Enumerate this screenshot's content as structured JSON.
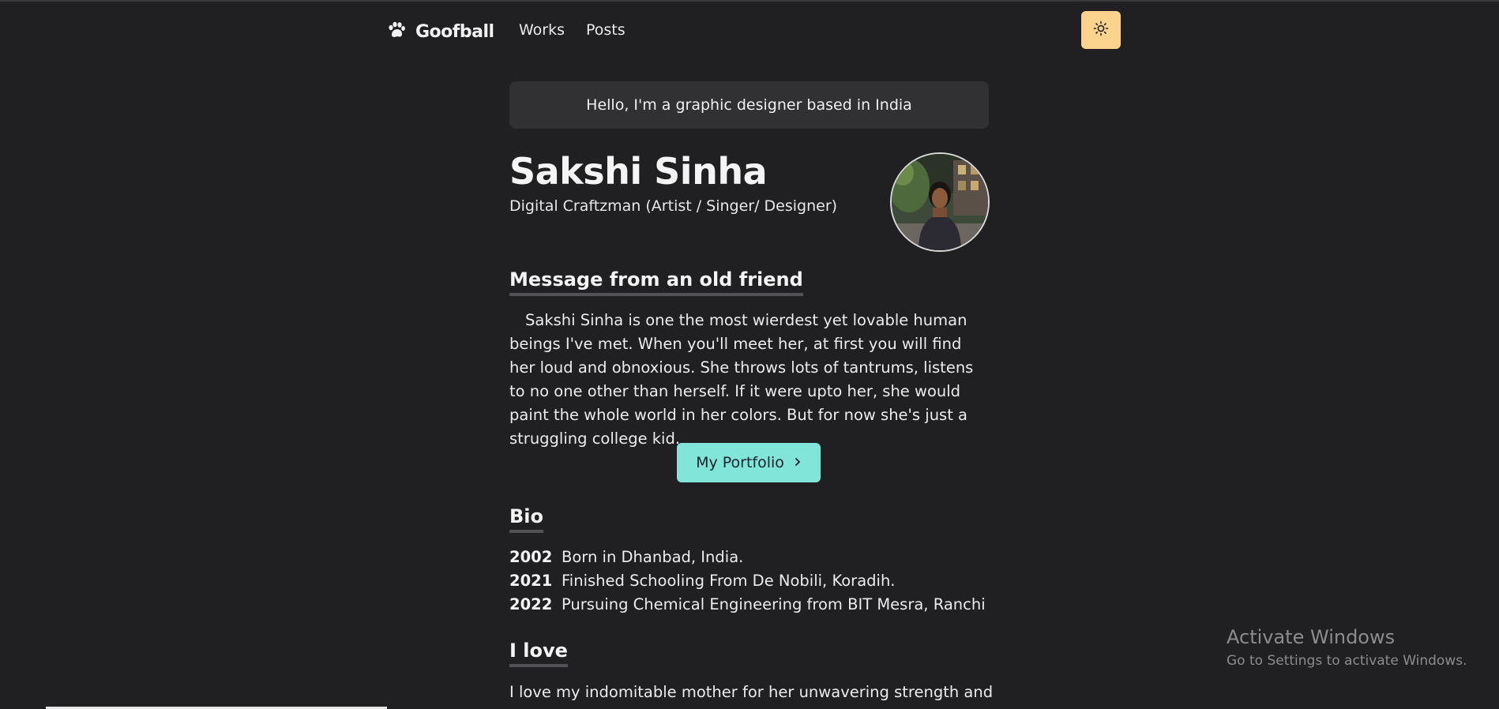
{
  "nav": {
    "brand": "Goofball",
    "links": [
      {
        "label": "Works"
      },
      {
        "label": "Posts"
      }
    ],
    "theme_toggle_icon": "sun-icon"
  },
  "hero": {
    "greeting": "Hello, I'm a graphic designer based in India",
    "name": "Sakshi Sinha",
    "subtitle": "Digital Craftzman (Artist / Singer/ Designer)"
  },
  "message": {
    "heading": "Message from an old friend",
    "body": "Sakshi Sinha is one the most wierdest yet lovable human beings I've met. When you'll meet her, at first you will find her loud and obnoxious. She throws lots of tantrums, listens to no one other than herself. If it were upto her, she would paint the whole world in her colors. But for now she's just a struggling college kid."
  },
  "portfolio_button": {
    "label": "My Portfolio",
    "icon": "chevron-right-icon"
  },
  "bio": {
    "heading": "Bio",
    "items": [
      {
        "year": "2002",
        "text": "Born in Dhanbad, India."
      },
      {
        "year": "2021",
        "text": "Finished Schooling From De Nobili, Koradih."
      },
      {
        "year": "2022",
        "text": "Pursuing Chemical Engineering from BIT Mesra, Ranchi"
      }
    ]
  },
  "love": {
    "heading": "I love",
    "body": "I love my indomitable mother for her unwavering strength and"
  },
  "watermark": {
    "title": "Activate Windows",
    "subtitle": "Go to Settings to activate Windows."
  },
  "colors": {
    "background": "#202023",
    "accent_teal": "#81e6d9",
    "theme_button": "#fbd38d"
  }
}
